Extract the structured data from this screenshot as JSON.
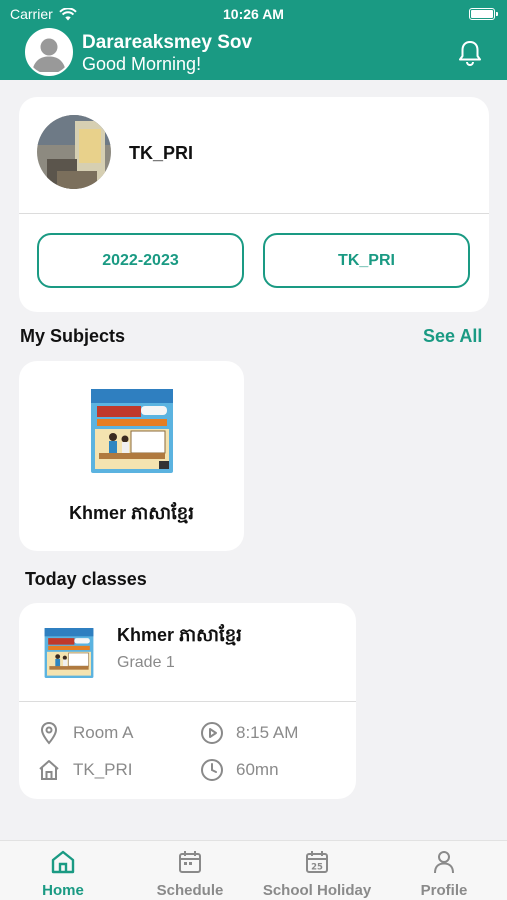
{
  "status_bar": {
    "carrier": "Carrier",
    "time": "10:26 AM"
  },
  "header": {
    "user_name": "Darareaksmey Sov",
    "greeting": "Good Morning!"
  },
  "school": {
    "name": "TK_PRI",
    "year_button": "2022-2023",
    "school_button": "TK_PRI"
  },
  "subjects": {
    "title": "My Subjects",
    "see_all": "See All",
    "items": [
      {
        "name": "Khmer ភាសាខ្មែរ"
      }
    ]
  },
  "today": {
    "title": "Today classes",
    "classes": [
      {
        "subject": "Khmer ភាសាខ្មែរ",
        "grade": "Grade 1",
        "room": "Room A",
        "time": "8:15 AM",
        "school": "TK_PRI",
        "duration": "60mn"
      }
    ]
  },
  "nav": [
    {
      "label": "Home",
      "icon": "home-icon",
      "active": true
    },
    {
      "label": "Schedule",
      "icon": "calendar-icon",
      "active": false
    },
    {
      "label": "School Holiday",
      "icon": "calendar-25-icon",
      "active": false
    },
    {
      "label": "Profile",
      "icon": "person-icon",
      "active": false
    }
  ],
  "colors": {
    "accent": "#1a9a83",
    "muted": "#8a8a8a",
    "background": "#f2f2f4"
  }
}
